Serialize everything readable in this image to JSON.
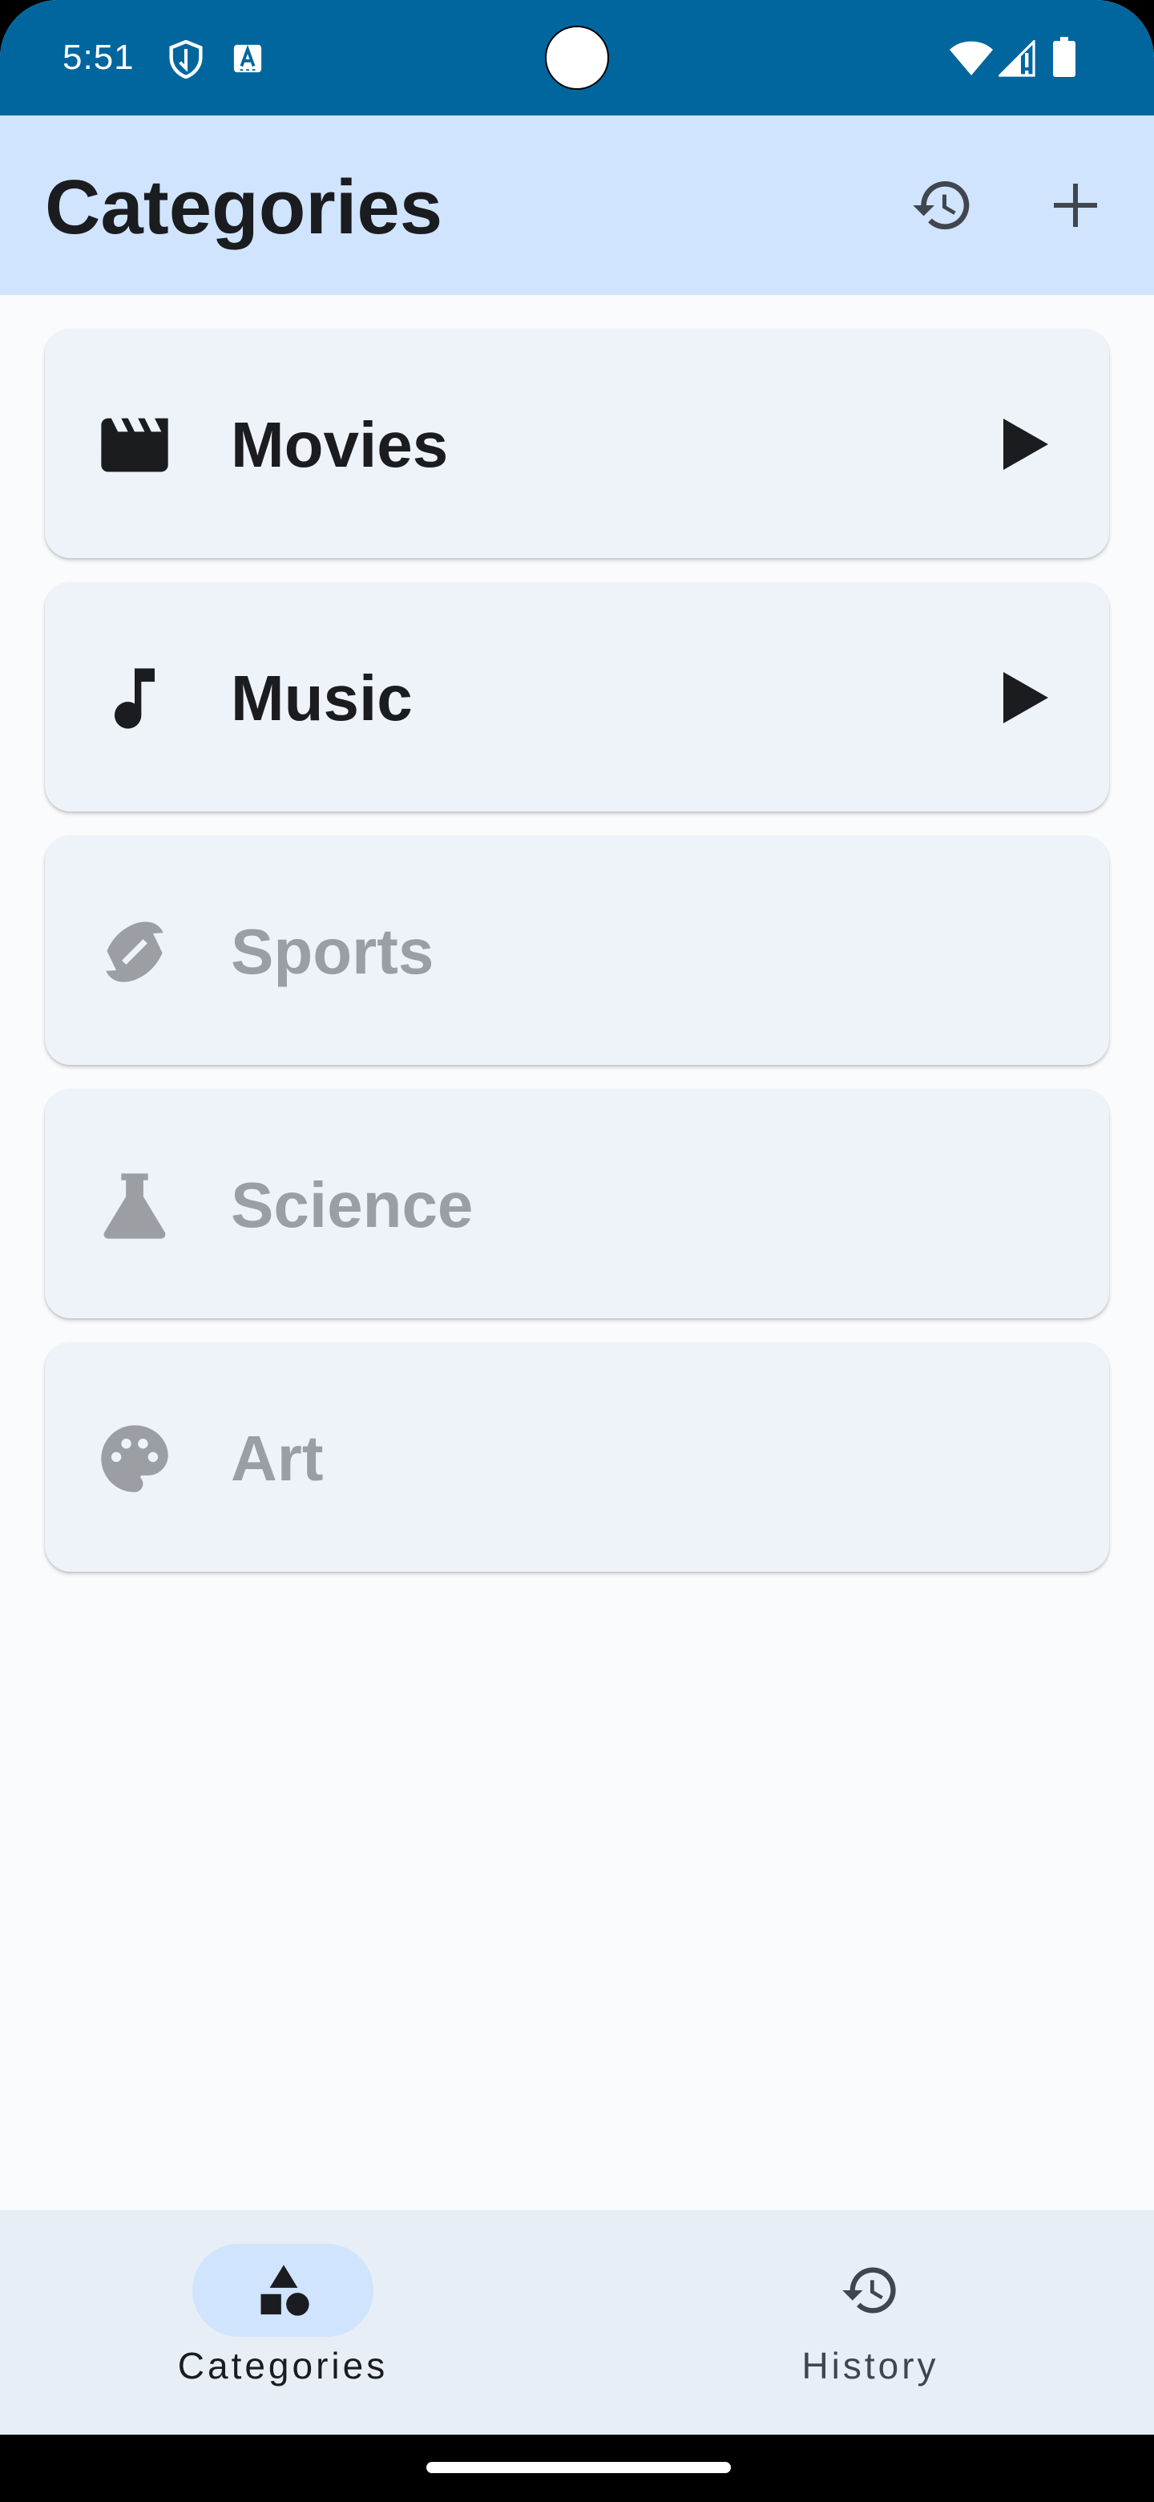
{
  "status_bar": {
    "time": "5:51",
    "icons": [
      "shield-icon",
      "text-recognition-icon",
      "wifi-icon",
      "cell-signal-icon",
      "battery-icon"
    ],
    "background": "#00669d"
  },
  "app_bar": {
    "title": "Categories",
    "actions": [
      "history-icon",
      "add-icon"
    ],
    "background": "#d0e4fd"
  },
  "categories": [
    {
      "label": "Movies",
      "icon": "movie-clapperboard-icon",
      "enabled": true,
      "trailing": "play-arrow-icon"
    },
    {
      "label": "Music",
      "icon": "music-note-icon",
      "enabled": true,
      "trailing": "play-arrow-icon"
    },
    {
      "label": "Sports",
      "icon": "football-icon",
      "enabled": false
    },
    {
      "label": "Science",
      "icon": "flask-icon",
      "enabled": false
    },
    {
      "label": "Art",
      "icon": "palette-icon",
      "enabled": false
    }
  ],
  "bottom_nav": {
    "items": [
      {
        "label": "Categories",
        "icon": "category-shapes-icon",
        "selected": true
      },
      {
        "label": "History",
        "icon": "history-icon",
        "selected": false
      }
    ]
  },
  "colors": {
    "card": "#eef3f9",
    "text": "#1a1c20",
    "disabled_text": "#9b9ea3",
    "nav_background": "#e7eef6"
  }
}
